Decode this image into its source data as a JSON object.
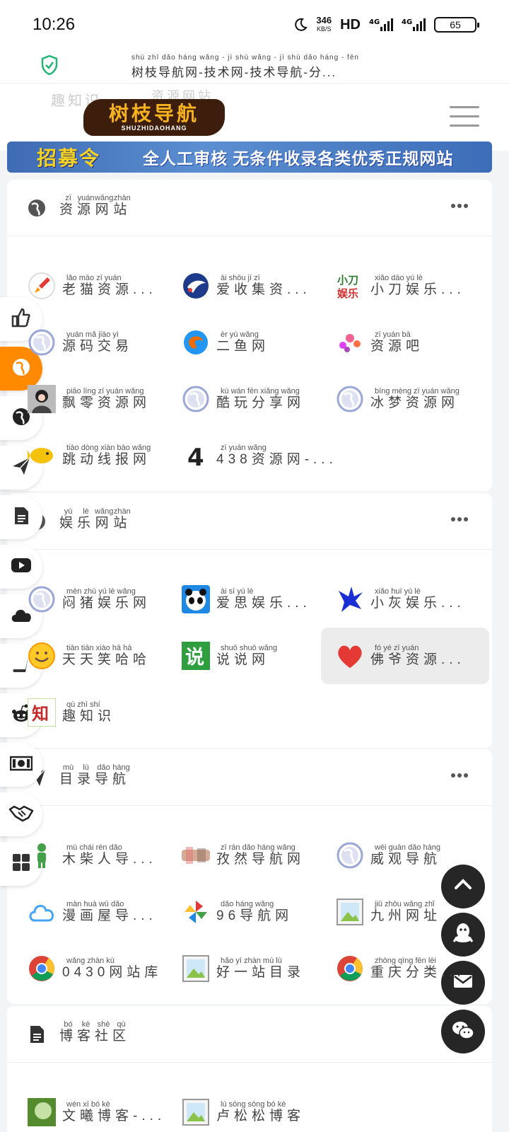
{
  "status": {
    "time": "10:26",
    "speed_value": "346",
    "speed_unit": "KB/S",
    "hd": "HD",
    "sig1": "⁴ᴳ",
    "sig2": "4G",
    "battery": "65"
  },
  "urlbar": {
    "pinyin": "shù zhī dǎo háng wǎng - jì shù wǎng - jì shù dǎo háng - fēn",
    "title": "树枝导航网-技术网-技术导航-分..."
  },
  "header": {
    "ghost_left": "趣知识",
    "ghost_right": "资源网站",
    "logo_main": "树枝导航",
    "logo_sub": "SHUZHIDAOHANG"
  },
  "banner": {
    "left": "招募令",
    "right": "全人工审核  无条件收录各类优秀正规网站"
  },
  "sections": [
    {
      "title_py": [
        "zī",
        "yuán",
        "wǎng",
        "zhàn"
      ],
      "title": [
        "资",
        "源",
        "网",
        "站"
      ],
      "icon": "globe-icon",
      "items": [
        {
          "py": "lǎo māo zī yuán",
          "name": "老猫资源...",
          "icon": "rocket-icon",
          "color": "#e53935"
        },
        {
          "py": "ài shōu jí zī",
          "name": "爱收集资...",
          "icon": "bird-icon",
          "color": "#1e3a8a"
        },
        {
          "py": "xiǎo dāo yú lè",
          "name": "小刀娱乐...",
          "icon": "knife-logo-icon",
          "color": "#d32f2f"
        },
        {
          "py": "yuán mǎ jiāo yì",
          "name": "源码交易",
          "icon": "globe-icon",
          "color": "#9aa7d6"
        },
        {
          "py": "èr yú wǎng",
          "name": "二鱼网",
          "icon": "swirl-icon",
          "color": "#ef6c00"
        },
        {
          "py": "zī yuán bā",
          "name": "资源吧",
          "icon": "dots-icon",
          "color": "#e040fb"
        },
        {
          "py": "piāo líng zī yuán wǎng",
          "name": "飘零资源网",
          "icon": "avatar-icon",
          "color": "#333333"
        },
        {
          "py": "kù wán fēn xiǎng wǎng",
          "name": "酷玩分享网",
          "icon": "globe-icon",
          "color": "#9aa7d6"
        },
        {
          "py": "bīng mèng zī yuán wǎng",
          "name": "冰梦资源网",
          "icon": "globe-icon",
          "color": "#9aa7d6"
        },
        {
          "py": "tiào dòng xiàn bào wǎng",
          "name": "跳动线报网",
          "icon": "fish-icon",
          "color": "#f4c20d"
        },
        {
          "py": "zī yuán wǎng",
          "name": "438资源网-...",
          "icon": "four-icon",
          "color": "#222222"
        }
      ]
    },
    {
      "title_py": [
        "yú",
        "lè",
        "wǎng",
        "zhàn"
      ],
      "title": [
        "娱",
        "乐",
        "网",
        "站"
      ],
      "icon": "globe-icon",
      "items": [
        {
          "py": "mèn zhū yú lè wǎng",
          "name": "闷猪娱乐网",
          "icon": "globe-icon",
          "color": "#9aa7d6"
        },
        {
          "py": "ài sī yú lè",
          "name": "爱思娱乐...",
          "icon": "panda-icon",
          "color": "#1e88e5"
        },
        {
          "py": "xiǎo huī yú lè",
          "name": "小灰娱乐...",
          "icon": "star-splash-icon",
          "color": "#1a2ed6"
        },
        {
          "py": "tiān tiān xiào hā hā",
          "name": "天天笑哈哈",
          "icon": "smiley-icon",
          "color": "#ff9800"
        },
        {
          "py": "shuō shuō wǎng",
          "name": "说说网",
          "icon": "shuo-icon",
          "color": "#2e9e3f"
        },
        {
          "py": "fó yé zī yuán",
          "name": "佛爷资源...",
          "icon": "heart-icon",
          "color": "#e53935"
        },
        {
          "py": "qù zhī shí",
          "name": "趣知识",
          "icon": "zhi-icon",
          "color": "#c62828"
        }
      ]
    },
    {
      "title_py": [
        "mù",
        "lù",
        "dǎo",
        "háng"
      ],
      "title": [
        "目",
        "录",
        "导",
        "航"
      ],
      "icon": "paper-plane-icon",
      "items": [
        {
          "py": "mù chái rén dǎo",
          "name": "木柴人导...",
          "icon": "person-icon",
          "color": "#43a047"
        },
        {
          "py": "zī rán dǎo háng wǎng",
          "name": "孜然导航网",
          "icon": "blur-icon",
          "color": "#c0876a"
        },
        {
          "py": "wēi guān dǎo háng",
          "name": "威观导航",
          "icon": "globe-icon",
          "color": "#9aa7d6"
        },
        {
          "py": "màn huà wū dǎo",
          "name": "漫画屋导...",
          "icon": "cloud-icon",
          "color": "#42a5f5"
        },
        {
          "py": "dǎo háng wǎng",
          "name": "96导航网",
          "icon": "pinwheel-icon",
          "color": "#e53935"
        },
        {
          "py": "jiǔ zhōu wǎng zhǐ",
          "name": "九州网址",
          "icon": "image-icon",
          "color": "#8bc34a"
        },
        {
          "py": "wǎng zhàn kù",
          "name": "0430网站库",
          "icon": "chrome-icon",
          "color": "#fbc02d"
        },
        {
          "py": "hǎo yī zhàn mù lù",
          "name": "好一站目录",
          "icon": "image-icon",
          "color": "#8bc34a"
        },
        {
          "py": "zhòng qìng fēn lèi",
          "name": "重庆分类...",
          "icon": "chrome-icon",
          "color": "#fbc02d"
        }
      ]
    },
    {
      "title_py": [
        "bó",
        "kè",
        "shè",
        "qū"
      ],
      "title": [
        "博",
        "客",
        "社",
        "区"
      ],
      "icon": "document-icon",
      "items": [
        {
          "py": "wén xī bó kè",
          "name": "文曦博客-...",
          "icon": "avatar-green-icon",
          "color": "#558b2f"
        },
        {
          "py": "lú sōng sōng bó kè",
          "name": "卢松松博客",
          "icon": "image-icon",
          "color": "#8bc34a"
        }
      ]
    }
  ],
  "left_nav": [
    "thumbs-up-icon",
    "globe-active-icon",
    "globe-icon",
    "paper-plane-icon",
    "document-icon",
    "youtube-icon",
    "cloud-icon",
    "book-icon",
    "reddit-icon",
    "money-icon",
    "handshake-icon",
    "grid-icon"
  ],
  "fabs": [
    "chevron-up-icon",
    "qq-icon",
    "mail-icon",
    "wechat-icon"
  ],
  "colors": {
    "accent": "#ff8a00",
    "fab": "#262626"
  }
}
